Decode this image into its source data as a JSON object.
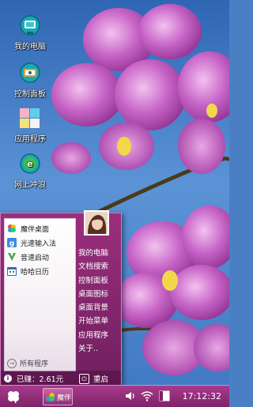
{
  "desktop": {
    "icons": [
      {
        "label": "我的电脑",
        "icon": "computer-icon"
      },
      {
        "label": "控制面板",
        "icon": "control-panel-icon"
      },
      {
        "label": "应用程序",
        "icon": "applications-icon"
      },
      {
        "label": "网上冲浪",
        "icon": "internet-icon"
      }
    ]
  },
  "start_menu": {
    "apps": [
      {
        "label": "魔伴桌面",
        "icon": "mobian-desktop-icon"
      },
      {
        "label": "光速输入法",
        "icon": "input-method-icon"
      },
      {
        "label": "音速启动",
        "icon": "quick-launch-icon"
      },
      {
        "label": "哈哈日历",
        "icon": "calendar-icon"
      }
    ],
    "all_programs": "所有程序",
    "right_items": [
      "我的电脑",
      "文档搜索",
      "控制面板",
      "桌面图标",
      "桌面背景",
      "开始菜单",
      "应用程序",
      "关于.."
    ],
    "earned": "已赚：2.61元",
    "restart": "重启"
  },
  "taskbar": {
    "task_label": "魔伴",
    "clock": "17:12:32"
  },
  "colors": {
    "menu_accent": "#8a2c72",
    "taskbar": "#9a3181"
  }
}
